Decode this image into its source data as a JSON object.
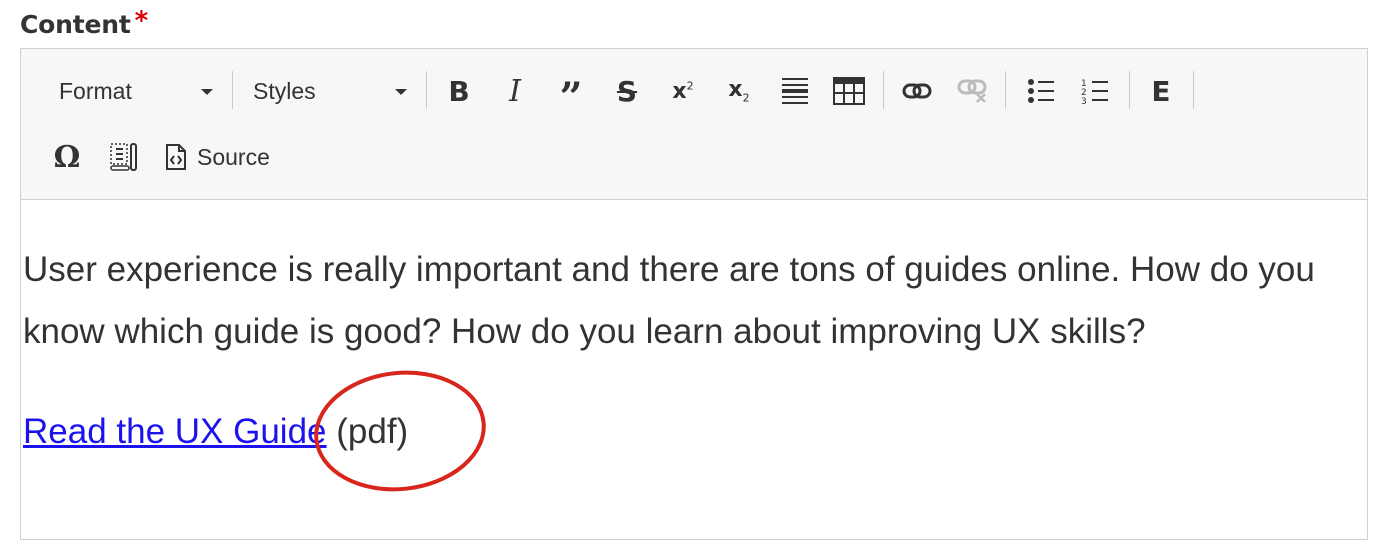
{
  "field": {
    "label": "Content",
    "required_marker": "*"
  },
  "toolbar": {
    "format_label": "Format",
    "styles_label": "Styles",
    "source_label": "Source",
    "icons": [
      "bold-icon",
      "italic-icon",
      "blockquote-icon",
      "strikethrough-icon",
      "superscript-icon",
      "subscript-icon",
      "horizontal-rule-icon",
      "table-icon",
      "link-icon",
      "unlink-icon",
      "bulleted-list-icon",
      "numbered-list-icon",
      "e-icon",
      "special-character-icon",
      "show-blocks-icon",
      "source-icon"
    ]
  },
  "content": {
    "paragraph_1": "User experience is really important and there are tons of guides online. How do you know which guide is good? How do you learn about improving UX skills?",
    "link_text": "Read the UX Guide",
    "link_suffix": " (pdf)"
  },
  "colors": {
    "link": "#1a13ee",
    "required": "#e00000",
    "annotation_circle": "#d9261c",
    "toolbar_bg": "#f7f7f7"
  }
}
